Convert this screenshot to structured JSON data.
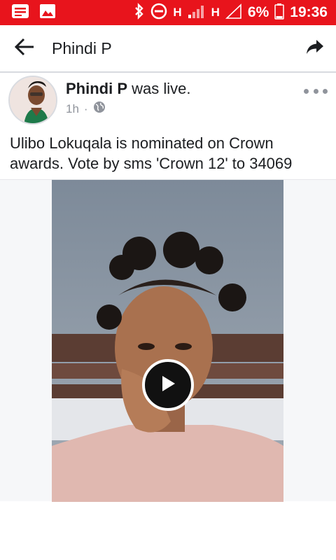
{
  "status_bar": {
    "battery": "6%",
    "time": "19:36",
    "network_1": "H",
    "network_2": "H",
    "icons": [
      "message-icon",
      "image-icon",
      "bluetooth-icon",
      "do-not-disturb-icon",
      "signal-icon",
      "battery-icon"
    ],
    "color": "#e8141c"
  },
  "app_bar": {
    "title": "Phindi P",
    "back_icon": "arrow-back-icon",
    "share_icon": "share-icon"
  },
  "post": {
    "author": "Phindi P",
    "action": " was live.",
    "time": "1h",
    "separator": "·",
    "privacy_icon": "globe-icon",
    "text": "Ulibo Lokuqala is nominated on Crown awards. Vote by sms 'Crown 12' to 34069",
    "video": {
      "play_icon": "play-icon"
    }
  }
}
